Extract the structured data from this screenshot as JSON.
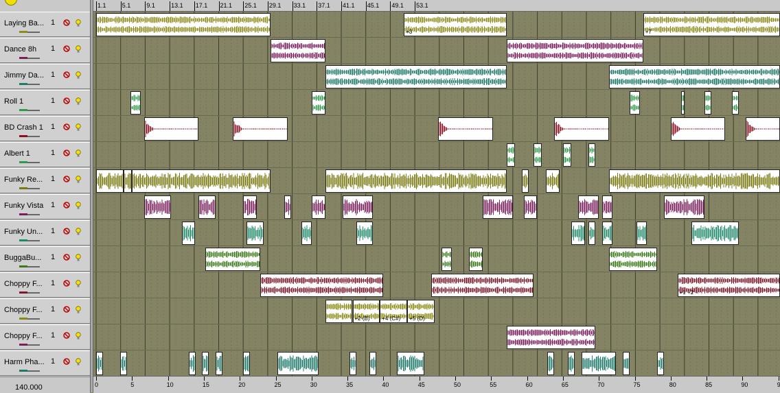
{
  "tracks": [
    {
      "name": "Laying Ba...",
      "num": "1",
      "color": "#8c8c1e",
      "kind": "wave"
    },
    {
      "name": "Dance 8h",
      "num": "1",
      "color": "#7a1f5c",
      "kind": "wave"
    },
    {
      "name": "Jimmy Da...",
      "num": "1",
      "color": "#1f7a6a",
      "kind": "wave"
    },
    {
      "name": "Roll 1",
      "num": "1",
      "color": "#2f9a4a",
      "kind": "short"
    },
    {
      "name": "BD Crash 1",
      "num": "1",
      "color": "#8a1020",
      "kind": "hit"
    },
    {
      "name": "Albert 1",
      "num": "1",
      "color": "#2f9a4a",
      "kind": "short"
    },
    {
      "name": "Funky Re...",
      "num": "1",
      "color": "#7a7a10",
      "kind": "loop"
    },
    {
      "name": "Funky Vista",
      "num": "1",
      "color": "#7a1f5c",
      "kind": "loop"
    },
    {
      "name": "Funky Un...",
      "num": "1",
      "color": "#1f8a6a",
      "kind": "loop"
    },
    {
      "name": "BuggaBu...",
      "num": "1",
      "color": "#3a7a1a",
      "kind": "wave"
    },
    {
      "name": "Choppy F...",
      "num": "1",
      "color": "#7a1a2a",
      "kind": "wave"
    },
    {
      "name": "Choppy F...",
      "num": "1",
      "color": "#8a8a10",
      "kind": "wave"
    },
    {
      "name": "Choppy F...",
      "num": "1",
      "color": "#7a1f5c",
      "kind": "wave"
    },
    {
      "name": "Harm Pha...",
      "num": "1",
      "color": "#1f7a6a",
      "kind": "loop"
    }
  ],
  "tempo": "140.000",
  "ruler_top": [
    "1.1",
    "5.1",
    "9.1",
    "13.1",
    "17.1",
    "21.1",
    "25.1",
    "29.1",
    "33.1",
    "37.1",
    "41.1",
    "45.1",
    "49.1",
    "53.1"
  ],
  "ruler_bottom": [
    "0",
    "5",
    "10",
    "15",
    "20",
    "25",
    "30",
    "35",
    "40",
    "45",
    "50",
    "55",
    "60",
    "65",
    "70",
    "75",
    "80",
    "85",
    "90",
    "95"
  ],
  "clips": [
    [
      {
        "s": 0,
        "e": 25.5
      },
      {
        "s": 45,
        "e": 60,
        "label": "+3"
      },
      {
        "s": 80,
        "e": 100,
        "label": "+7"
      }
    ],
    [
      {
        "s": 25.5,
        "e": 33.5
      },
      {
        "s": 60,
        "e": 80
      }
    ],
    [
      {
        "s": 33.5,
        "e": 60
      },
      {
        "s": 75,
        "e": 100
      }
    ],
    [
      {
        "s": 5,
        "e": 6.5
      },
      {
        "s": 31.5,
        "e": 33.5
      },
      {
        "s": 78,
        "e": 79.5
      },
      {
        "s": 85.5,
        "e": 86
      },
      {
        "s": 89,
        "e": 90
      },
      {
        "s": 93,
        "e": 94
      }
    ],
    [
      {
        "s": 7,
        "e": 15
      },
      {
        "s": 20,
        "e": 28
      },
      {
        "s": 50,
        "e": 58
      },
      {
        "s": 67,
        "e": 75
      },
      {
        "s": 84,
        "e": 92
      },
      {
        "s": 95,
        "e": 100
      }
    ],
    [
      {
        "s": 60,
        "e": 61.2
      },
      {
        "s": 64,
        "e": 65.2
      },
      {
        "s": 68.3,
        "e": 69.5
      },
      {
        "s": 72,
        "e": 73
      }
    ],
    [
      {
        "s": 0,
        "e": 4
      },
      {
        "s": 4,
        "e": 5.2
      },
      {
        "s": 5.2,
        "e": 25.5
      },
      {
        "s": 33.5,
        "e": 60
      },
      {
        "s": 62.2,
        "e": 63.2
      },
      {
        "s": 65.8,
        "e": 67.8
      },
      {
        "s": 75,
        "e": 100
      }
    ],
    [
      {
        "s": 7,
        "e": 11
      },
      {
        "s": 15,
        "e": 17.5
      },
      {
        "s": 21.5,
        "e": 23.5
      },
      {
        "s": 27.5,
        "e": 28.5
      },
      {
        "s": 31.5,
        "e": 33.5
      },
      {
        "s": 36,
        "e": 40.5
      },
      {
        "s": 56.5,
        "e": 61
      },
      {
        "s": 62.5,
        "e": 64.5
      },
      {
        "s": 70.5,
        "e": 73.5
      },
      {
        "s": 74,
        "e": 75.5
      },
      {
        "s": 83,
        "e": 89
      }
    ],
    [
      {
        "s": 12.5,
        "e": 14.5
      },
      {
        "s": 22,
        "e": 24.5
      },
      {
        "s": 30,
        "e": 31.5
      },
      {
        "s": 38,
        "e": 40.5
      },
      {
        "s": 69.5,
        "e": 71.5
      },
      {
        "s": 72,
        "e": 73
      },
      {
        "s": 74,
        "e": 75.5
      },
      {
        "s": 79,
        "e": 80.5
      },
      {
        "s": 87,
        "e": 94
      }
    ],
    [
      {
        "s": 16,
        "e": 24
      },
      {
        "s": 50.5,
        "e": 52
      },
      {
        "s": 54.5,
        "e": 56.5
      },
      {
        "s": 75,
        "e": 82
      }
    ],
    [
      {
        "s": 24,
        "e": 42
      },
      {
        "s": 49,
        "e": 64
      },
      {
        "s": 85,
        "e": 100,
        "label": "+1  +2"
      }
    ],
    [
      {
        "s": 33.5,
        "e": 37.5
      },
      {
        "s": 37.5,
        "e": 41.5,
        "label": "+2 (B)"
      },
      {
        "s": 41.5,
        "e": 45.5,
        "label": "+4 (C#)"
      },
      {
        "s": 45.5,
        "e": 49.5,
        "label": "+5 (D)"
      }
    ],
    [
      {
        "s": 60,
        "e": 73
      }
    ],
    [
      {
        "s": 0,
        "e": 1
      },
      {
        "s": 3.5,
        "e": 4.5
      },
      {
        "s": 13.5,
        "e": 14.5
      },
      {
        "s": 15.5,
        "e": 16.5
      },
      {
        "s": 17.5,
        "e": 18.5
      },
      {
        "s": 21.5,
        "e": 22.5
      },
      {
        "s": 26.5,
        "e": 32.5
      },
      {
        "s": 37,
        "e": 38
      },
      {
        "s": 40,
        "e": 41
      },
      {
        "s": 44,
        "e": 48
      },
      {
        "s": 66,
        "e": 67
      },
      {
        "s": 69,
        "e": 70
      },
      {
        "s": 71,
        "e": 76
      },
      {
        "s": 77,
        "e": 78
      },
      {
        "s": 82,
        "e": 83
      }
    ]
  ]
}
